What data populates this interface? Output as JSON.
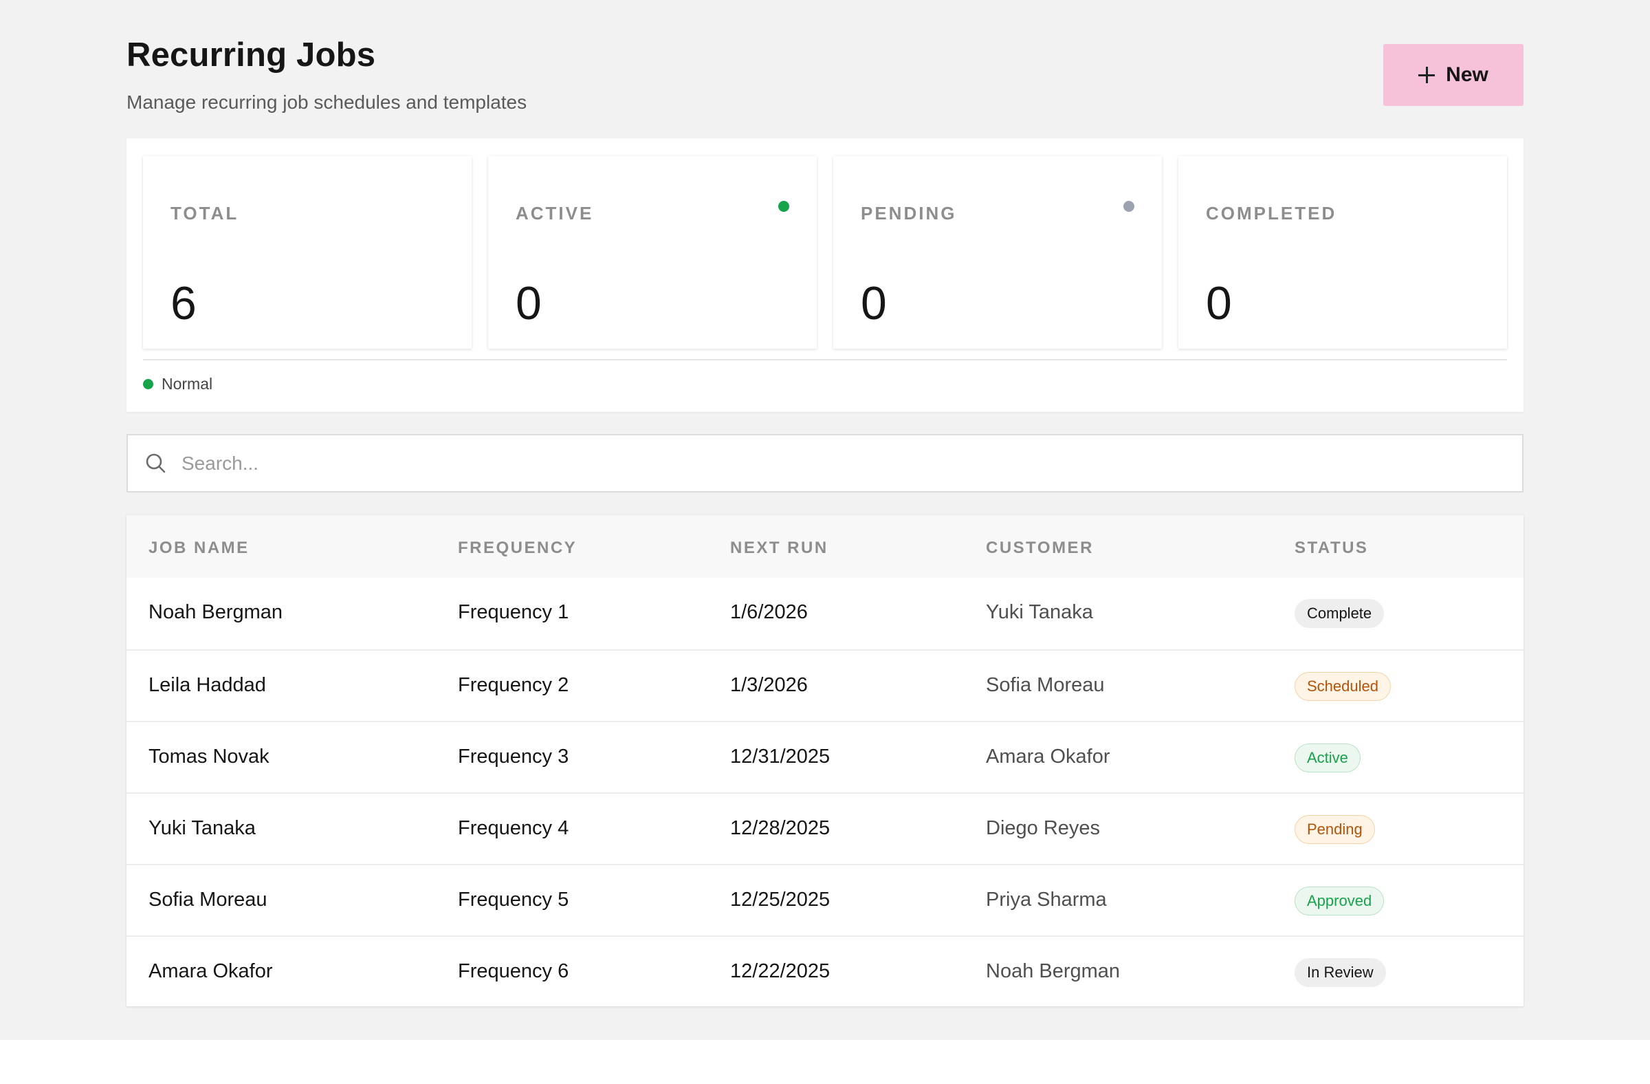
{
  "header": {
    "title": "Recurring Jobs",
    "subtitle": "Manage recurring job schedules and templates",
    "new_button_label": "New"
  },
  "stats": [
    {
      "label": "TOTAL",
      "value": "6",
      "dot": null
    },
    {
      "label": "ACTIVE",
      "value": "0",
      "dot": "#16a34a"
    },
    {
      "label": "PENDING",
      "value": "0",
      "dot": "#9ca3af"
    },
    {
      "label": "COMPLETED",
      "value": "0",
      "dot": null
    }
  ],
  "legend": {
    "label": "Normal",
    "color": "#16a34a"
  },
  "search": {
    "placeholder": "Search...",
    "value": ""
  },
  "table": {
    "columns": [
      "JOB NAME",
      "FREQUENCY",
      "NEXT RUN",
      "CUSTOMER",
      "STATUS"
    ],
    "rows": [
      {
        "job": "Noah Bergman",
        "frequency": "Frequency 1",
        "next_run": "1/6/2026",
        "customer": "Yuki Tanaka",
        "status": "Complete"
      },
      {
        "job": "Leila Haddad",
        "frequency": "Frequency 2",
        "next_run": "1/3/2026",
        "customer": "Sofia Moreau",
        "status": "Scheduled"
      },
      {
        "job": "Tomas Novak",
        "frequency": "Frequency 3",
        "next_run": "12/31/2025",
        "customer": "Amara Okafor",
        "status": "Active"
      },
      {
        "job": "Yuki Tanaka",
        "frequency": "Frequency 4",
        "next_run": "12/28/2025",
        "customer": "Diego Reyes",
        "status": "Pending"
      },
      {
        "job": "Sofia Moreau",
        "frequency": "Frequency 5",
        "next_run": "12/25/2025",
        "customer": "Priya Sharma",
        "status": "Approved"
      },
      {
        "job": "Amara Okafor",
        "frequency": "Frequency 6",
        "next_run": "12/22/2025",
        "customer": "Noah Bergman",
        "status": "In Review"
      }
    ]
  },
  "status_styles": {
    "Complete": {
      "bg": "#eeeeee",
      "fg": "#161616",
      "border": "#eeeeee"
    },
    "Scheduled": {
      "bg": "#fff4e5",
      "fg": "#b4530a",
      "border": "#f8d2a6"
    },
    "Active": {
      "bg": "#ecf8ef",
      "fg": "#16a34a",
      "border": "#b9e2c4"
    },
    "Pending": {
      "bg": "#fff4e5",
      "fg": "#b4530a",
      "border": "#f8d2a6"
    },
    "Approved": {
      "bg": "#ecf8ef",
      "fg": "#16a34a",
      "border": "#b9e2c4"
    },
    "In Review": {
      "bg": "#eeeeee",
      "fg": "#161616",
      "border": "#eeeeee"
    }
  },
  "accent": "#f5c2d9"
}
